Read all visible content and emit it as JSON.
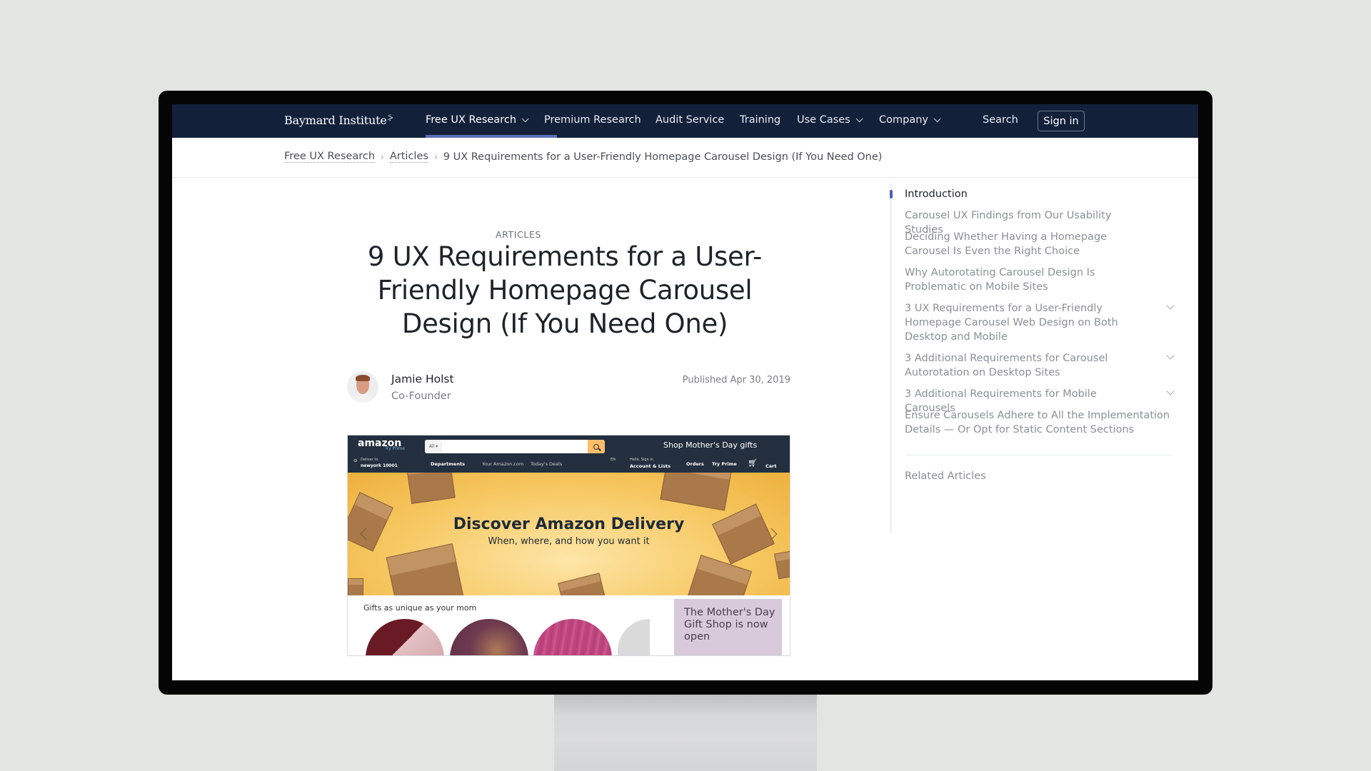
{
  "site": {
    "logo": "Baymard Institute",
    "nav": [
      {
        "label": "Free UX Research",
        "dropdown": true,
        "active": true
      },
      {
        "label": "Premium Research",
        "dropdown": false
      },
      {
        "label": "Audit Service",
        "dropdown": false
      },
      {
        "label": "Training",
        "dropdown": false
      },
      {
        "label": "Use Cases",
        "dropdown": true
      },
      {
        "label": "Company",
        "dropdown": true
      }
    ],
    "search_label": "Search",
    "signin_label": "Sign in",
    "colors": {
      "nav_bg": "#13203a",
      "accent": "#5b6fb8"
    }
  },
  "breadcrumb": [
    {
      "label": "Free UX Research",
      "link": true
    },
    {
      "label": "Articles",
      "link": true
    },
    {
      "label": "9 UX Requirements for a User-Friendly Homepage Carousel Design (If You Need One)",
      "link": false
    }
  ],
  "article": {
    "eyebrow": "ARTICLES",
    "title": "9 UX Requirements for a User-Friendly Homepage Carousel Design (If You Need One)",
    "author": {
      "name": "Jamie Holst",
      "role": "Co-Founder"
    },
    "published": "Published Apr 30, 2019"
  },
  "hero_image": {
    "amazon": {
      "logo": "amazon",
      "prime": "Try Prime",
      "search_scope": "All",
      "promo": "Shop Mother's Day gifts",
      "deliver_to": "Deliver to",
      "location": "newyork 10001",
      "departments": "Departments",
      "your_amazon": "Your Amazon.com",
      "todays_deals": "Today's Deals",
      "lang": "EN",
      "hello": "Hello. Sign in",
      "account": "Account & Lists",
      "orders": "Orders",
      "try_prime": "Try Prime",
      "cart_count": "0",
      "cart": "Cart",
      "banner_title": "Discover Amazon Delivery",
      "banner_subtitle": "When, where, and how you want it",
      "gifts_title": "Gifts as unique as your mom",
      "mothers_day": "The Mother's Day Gift Shop is now open"
    }
  },
  "toc": {
    "items": [
      {
        "label": "Introduction",
        "active": true,
        "expandable": false
      },
      {
        "label": "Carousel UX Findings from Our Usability Studies",
        "active": false,
        "expandable": false
      },
      {
        "label": "Deciding Whether Having a Homepage Carousel Is Even the Right Choice",
        "active": false,
        "expandable": false
      },
      {
        "label": "Why Autorotating Carousel Design Is Problematic on Mobile Sites",
        "active": false,
        "expandable": false
      },
      {
        "label": "3 UX Requirements for a User-Friendly Homepage Carousel Web Design on Both Desktop and Mobile",
        "active": false,
        "expandable": true
      },
      {
        "label": "3 Additional Requirements for Carousel Autorotation on Desktop Sites",
        "active": false,
        "expandable": true
      },
      {
        "label": "3 Additional Requirements for Mobile Carousels",
        "active": false,
        "expandable": true
      },
      {
        "label": "Ensure Carousels Adhere to All the Implementation Details — Or Opt for Static Content Sections",
        "active": false,
        "expandable": false
      }
    ],
    "related": "Related Articles"
  }
}
